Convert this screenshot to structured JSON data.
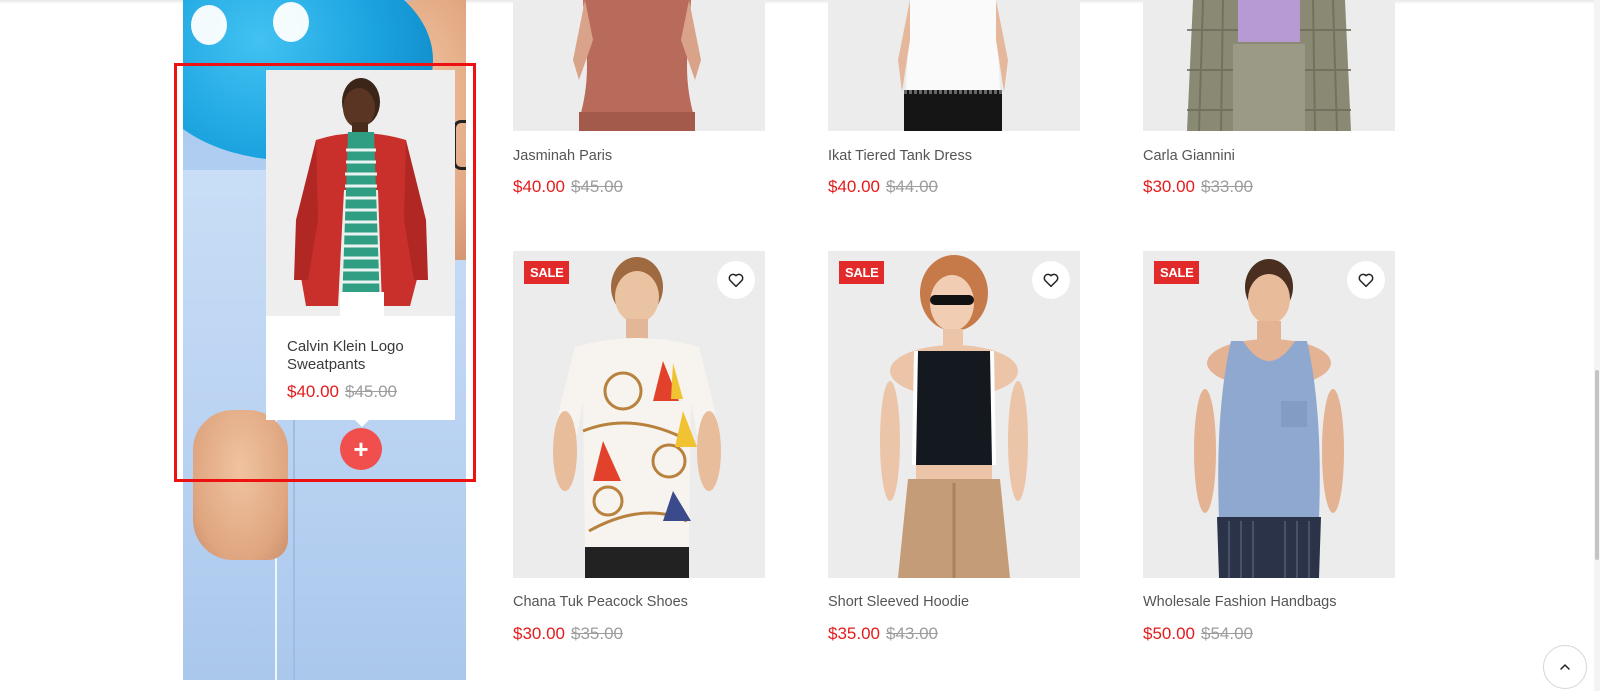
{
  "popup": {
    "title": "Calvin Klein Logo Sweatpants",
    "price": "$40.00",
    "old_price": "$45.00",
    "add_button": "+"
  },
  "top_products": [
    {
      "name": "Jasminah Paris",
      "price": "$40.00",
      "old_price": "$45.00"
    },
    {
      "name": "Ikat Tiered Tank Dress",
      "price": "$40.00",
      "old_price": "$44.00"
    },
    {
      "name": "Carla Giannini",
      "price": "$30.00",
      "old_price": "$33.00"
    }
  ],
  "products": [
    {
      "badge": "SALE",
      "name": "Chana Tuk Peacock Shoes",
      "price": "$30.00",
      "old_price": "$35.00"
    },
    {
      "badge": "SALE",
      "name": "Short Sleeved Hoodie",
      "price": "$35.00",
      "old_price": "$43.00"
    },
    {
      "badge": "SALE",
      "name": "Wholesale Fashion Handbags",
      "price": "$50.00",
      "old_price": "$54.00"
    }
  ],
  "icons": {
    "wishlist": "heart-icon",
    "add": "plus-icon",
    "scroll_top": "chevron-up-icon"
  },
  "colors": {
    "sale_price": "#e31b1b",
    "old_price": "#9d9d9d",
    "sale_badge": "#e22a2a",
    "add_button": "#f14e4e",
    "highlight": "#ee1111"
  }
}
